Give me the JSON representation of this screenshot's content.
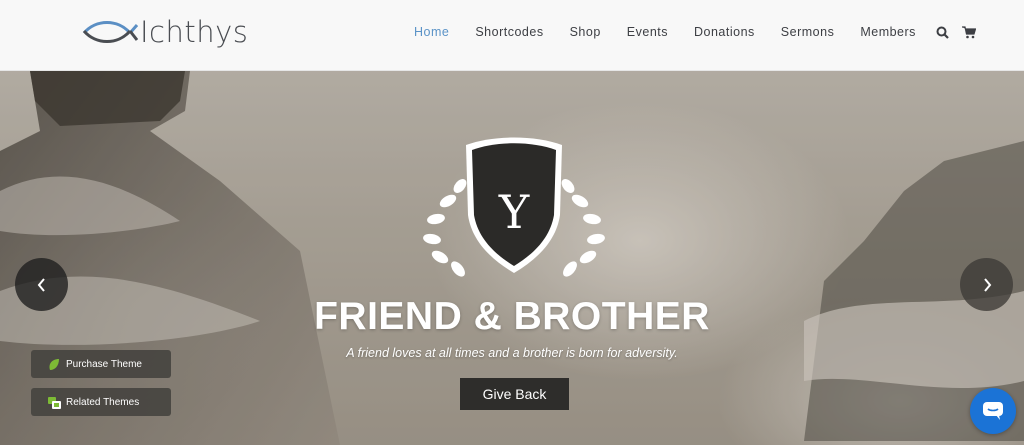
{
  "brand": {
    "name": "Ichthys",
    "accent": "#5b93c7"
  },
  "nav": {
    "items": [
      {
        "label": "Home",
        "active": true
      },
      {
        "label": "Shortcodes",
        "active": false
      },
      {
        "label": "Shop",
        "active": false
      },
      {
        "label": "Events",
        "active": false
      },
      {
        "label": "Donations",
        "active": false
      },
      {
        "label": "Sermons",
        "active": false
      },
      {
        "label": "Members",
        "active": false
      }
    ],
    "icons": [
      "search-icon",
      "cart-icon"
    ]
  },
  "hero": {
    "crest_letter": "Y",
    "title": "FRIEND & BROTHER",
    "subtitle": "A friend loves at all times and a brother is born for adversity.",
    "button_label": "Give Back",
    "prev_icon": "chevron-left-icon",
    "next_icon": "chevron-right-icon"
  },
  "side_buttons": {
    "purchase": {
      "label": "Purchase Theme",
      "icon": "leaf-icon",
      "color": "#7dbb35"
    },
    "related": {
      "label": "Related Themes",
      "icon": "themes-icon",
      "color": "#7dbb35"
    }
  },
  "chat": {
    "icon": "chat-bubble-icon",
    "color": "#1b73d6"
  }
}
